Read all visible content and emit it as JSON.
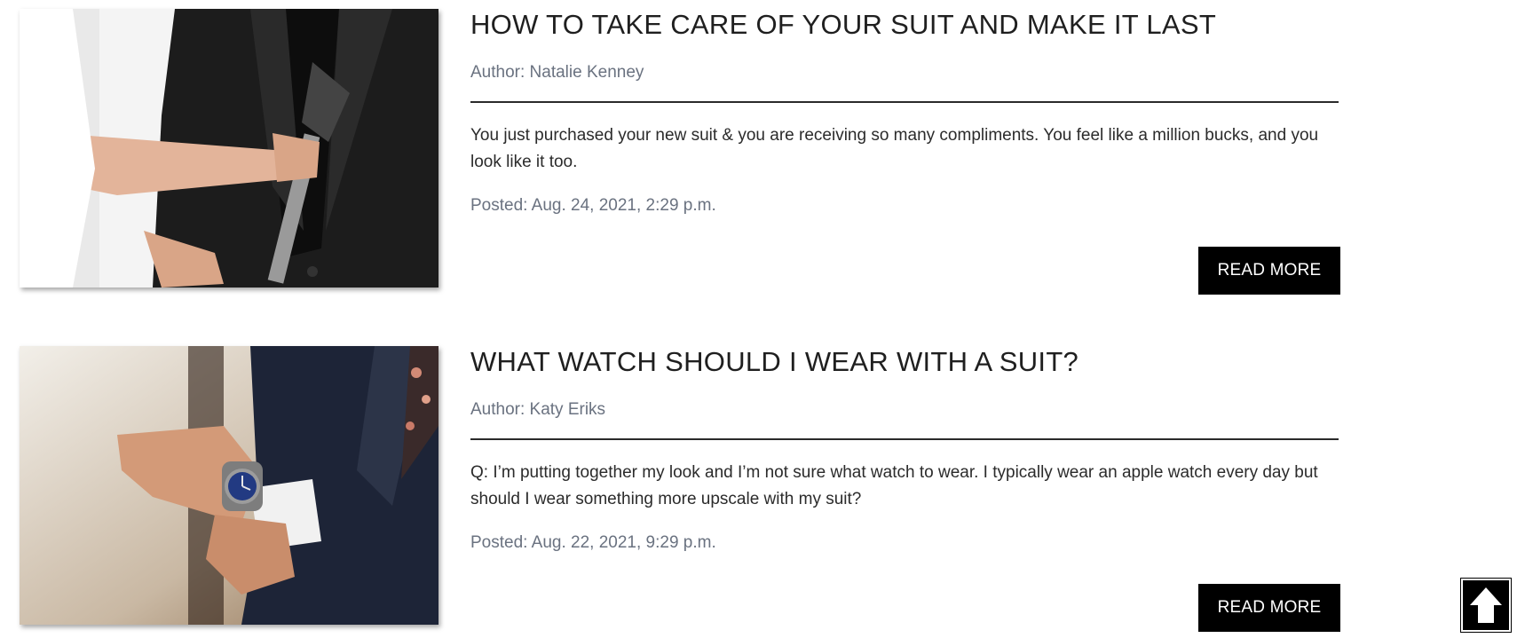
{
  "posts": [
    {
      "title": "HOW TO TAKE CARE OF YOUR SUIT AND MAKE IT LAST",
      "author": "Author: Natalie Kenney",
      "excerpt": "You just purchased your new suit & you are receiving so many compliments. You feel like a million bucks, and you look like it too.",
      "posted": "Posted: Aug. 24, 2021, 2:29 p.m.",
      "read_more_label": "READ MORE",
      "image_alt": "Steaming a black suit jacket"
    },
    {
      "title": "WHAT WATCH SHOULD I WEAR WITH A SUIT?",
      "author": "Author: Katy Eriks",
      "excerpt": "Q: I’m putting together my look and I’m not sure what watch to wear. I typically wear an apple watch every day but should I wear something more upscale with my suit?",
      "posted": "Posted: Aug. 22, 2021, 9:29 p.m.",
      "read_more_label": "READ MORE",
      "image_alt": "Man adjusting a wristwatch with a navy suit"
    }
  ],
  "back_to_top_icon": "arrow-up-icon"
}
